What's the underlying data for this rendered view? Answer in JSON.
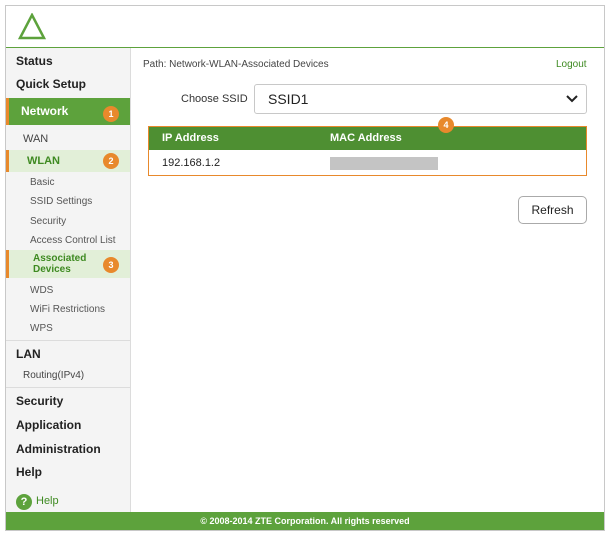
{
  "header": {
    "logo_icon": "green-triangle-logo"
  },
  "sidebar": {
    "status": "Status",
    "quick_setup": "Quick Setup",
    "network": "Network",
    "network_badge": "1",
    "wan": "WAN",
    "wlan": "WLAN",
    "wlan_badge": "2",
    "basic": "Basic",
    "ssid_settings": "SSID Settings",
    "security_sub": "Security",
    "acl": "Access Control List",
    "associated_line1": "Associated",
    "associated_line2": "Devices",
    "associated_badge": "3",
    "wds": "WDS",
    "wifi_restrictions": "WiFi Restrictions",
    "wps": "WPS",
    "lan": "LAN",
    "routing": "Routing(IPv4)",
    "security": "Security",
    "application": "Application",
    "administration": "Administration",
    "help": "Help",
    "help_link": "Help"
  },
  "main": {
    "path": "Path: Network-WLAN-Associated Devices",
    "logout": "Logout",
    "choose_ssid_label": "Choose SSID",
    "ssid_selected": "SSID1",
    "table_badge": "4",
    "columns": [
      "IP Address",
      "MAC Address"
    ],
    "rows": [
      {
        "ip": "192.168.1.2"
      }
    ],
    "refresh": "Refresh"
  },
  "footer": {
    "copyright": "© 2008-2014 ZTE Corporation. All rights reserved"
  },
  "colors": {
    "brand_green": "#5da23c",
    "badge_orange": "#e8892c",
    "table_header": "#4e8f32"
  }
}
